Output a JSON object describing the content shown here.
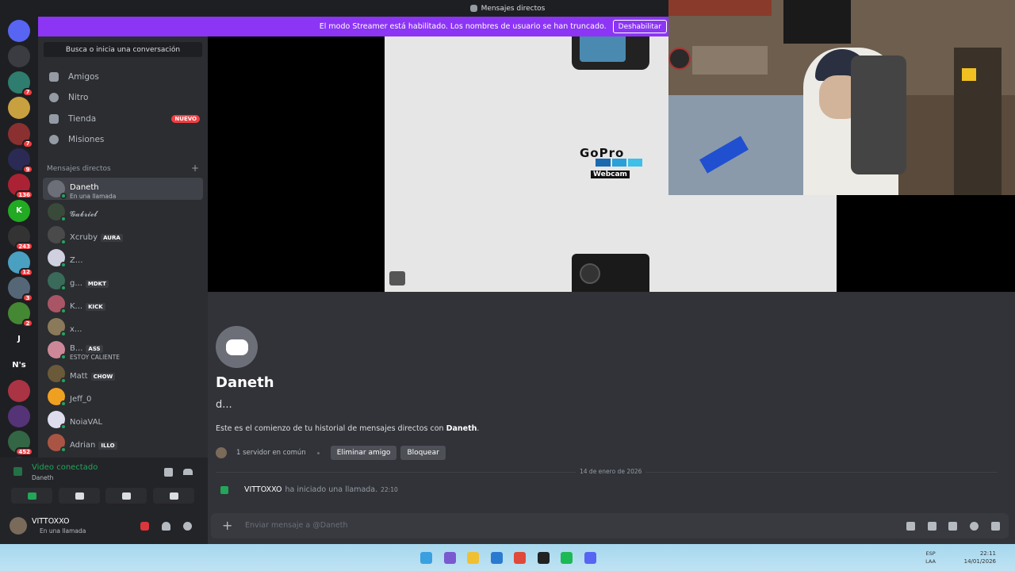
{
  "window": {
    "title": "Mensajes directos"
  },
  "banner": {
    "text": "El modo Streamer está habilitado. Los nombres de usuario se han truncado.",
    "button": "Deshabilitar"
  },
  "servers": [
    {
      "label": "",
      "badge": "",
      "color": "#5865f2"
    },
    {
      "label": "",
      "badge": "",
      "color": "#3a3c42"
    },
    {
      "label": "",
      "badge": "7",
      "color": "#2e7d6e"
    },
    {
      "label": "",
      "badge": "",
      "color": "#c8a040"
    },
    {
      "label": "",
      "badge": "7",
      "color": "#8a3030"
    },
    {
      "label": "",
      "badge": "9",
      "color": "#2a2a55"
    },
    {
      "label": "",
      "badge": "136",
      "color": "#aa2233"
    },
    {
      "label": "K",
      "badge": "",
      "color": "#22aa22"
    },
    {
      "label": "",
      "badge": "243",
      "color": "#333333"
    },
    {
      "label": "",
      "badge": "12",
      "color": "#4aa0c0"
    },
    {
      "label": "",
      "badge": "3",
      "color": "#556677"
    },
    {
      "label": "",
      "badge": "2",
      "color": "#448833"
    },
    {
      "label": "J",
      "badge": "",
      "color": "#1e1f22"
    },
    {
      "label": "N's",
      "badge": "",
      "color": "#1e1f22"
    },
    {
      "label": "",
      "badge": "",
      "color": "#aa3344"
    },
    {
      "label": "",
      "badge": "",
      "color": "#553377"
    },
    {
      "label": "",
      "badge": "452",
      "color": "#336644"
    },
    {
      "label": "+",
      "badge": "",
      "color": "#313338"
    }
  ],
  "sidebar": {
    "search": "Busca o inicia una conversación",
    "nav": [
      {
        "label": "Amigos"
      },
      {
        "label": "Nitro"
      },
      {
        "label": "Tienda",
        "badge": "NUEVO"
      },
      {
        "label": "Misiones"
      }
    ],
    "dm_header": "Mensajes directos",
    "dm_add": "+",
    "dms": [
      {
        "name": "Daneth",
        "sub": "En una llamada",
        "tag": "",
        "color": "#6d6f78"
      },
      {
        "name": "𝓖𝓪𝓫𝓻𝓲𝓮𝓵",
        "sub": "",
        "tag": "",
        "color": "#3a4a3a"
      },
      {
        "name": "Xcruby",
        "sub": "",
        "tag": "AURA",
        "color": "#4a4a4a"
      },
      {
        "name": "Z...",
        "sub": "",
        "tag": "",
        "color": "#d0d0e0"
      },
      {
        "name": "g...",
        "sub": "",
        "tag": "MDKT",
        "color": "#3a6a5a"
      },
      {
        "name": "K...",
        "sub": "",
        "tag": "KICK",
        "color": "#aa5566"
      },
      {
        "name": "x...",
        "sub": "",
        "tag": "",
        "color": "#8a7a5a"
      },
      {
        "name": "B...",
        "sub": "ESTOY CALIENTE",
        "tag": "ASS",
        "color": "#cc8899"
      },
      {
        "name": "Matt",
        "sub": "",
        "tag": "CHOW",
        "color": "#6a5a3a"
      },
      {
        "name": "Jeff_0",
        "sub": "",
        "tag": "",
        "color": "#f0a020"
      },
      {
        "name": "NoiaVAL",
        "sub": "",
        "tag": "",
        "color": "#ddddee"
      },
      {
        "name": "Adrian",
        "sub": "",
        "tag": "ILLO",
        "color": "#aa5544"
      }
    ]
  },
  "voice": {
    "status": "Video conectado",
    "channel": "Daneth"
  },
  "user": {
    "name": "VITTOXXO",
    "status": "En una llamada"
  },
  "chat": {
    "name": "Daneth",
    "handle": "d...",
    "intro_prefix": "Este es el comienzo de tu historial de mensajes directos con ",
    "intro_name": "Daneth",
    "intro_suffix": ".",
    "mutual": "1 servidor en común",
    "remove_friend": "Eliminar amigo",
    "block": "Bloquear",
    "date_divider": "14 de enero de 2026",
    "call_user": "VITTOXXO",
    "call_text": "ha iniciado una llamada.",
    "call_time": "22:10",
    "composer_placeholder": "Enviar mensaje a @Daneth"
  },
  "video": {
    "brand": "GoPro",
    "sub": "Webcam"
  },
  "taskbar": {
    "lang": [
      "ESP",
      "LAA"
    ],
    "time": "22:11",
    "date": "14/01/2026",
    "apps": [
      "#3aa0e0",
      "#7a5ad0",
      "#f0c030",
      "#2a7ad0",
      "#e04a3a",
      "#222222",
      "#1db954",
      "#5865f2"
    ]
  }
}
